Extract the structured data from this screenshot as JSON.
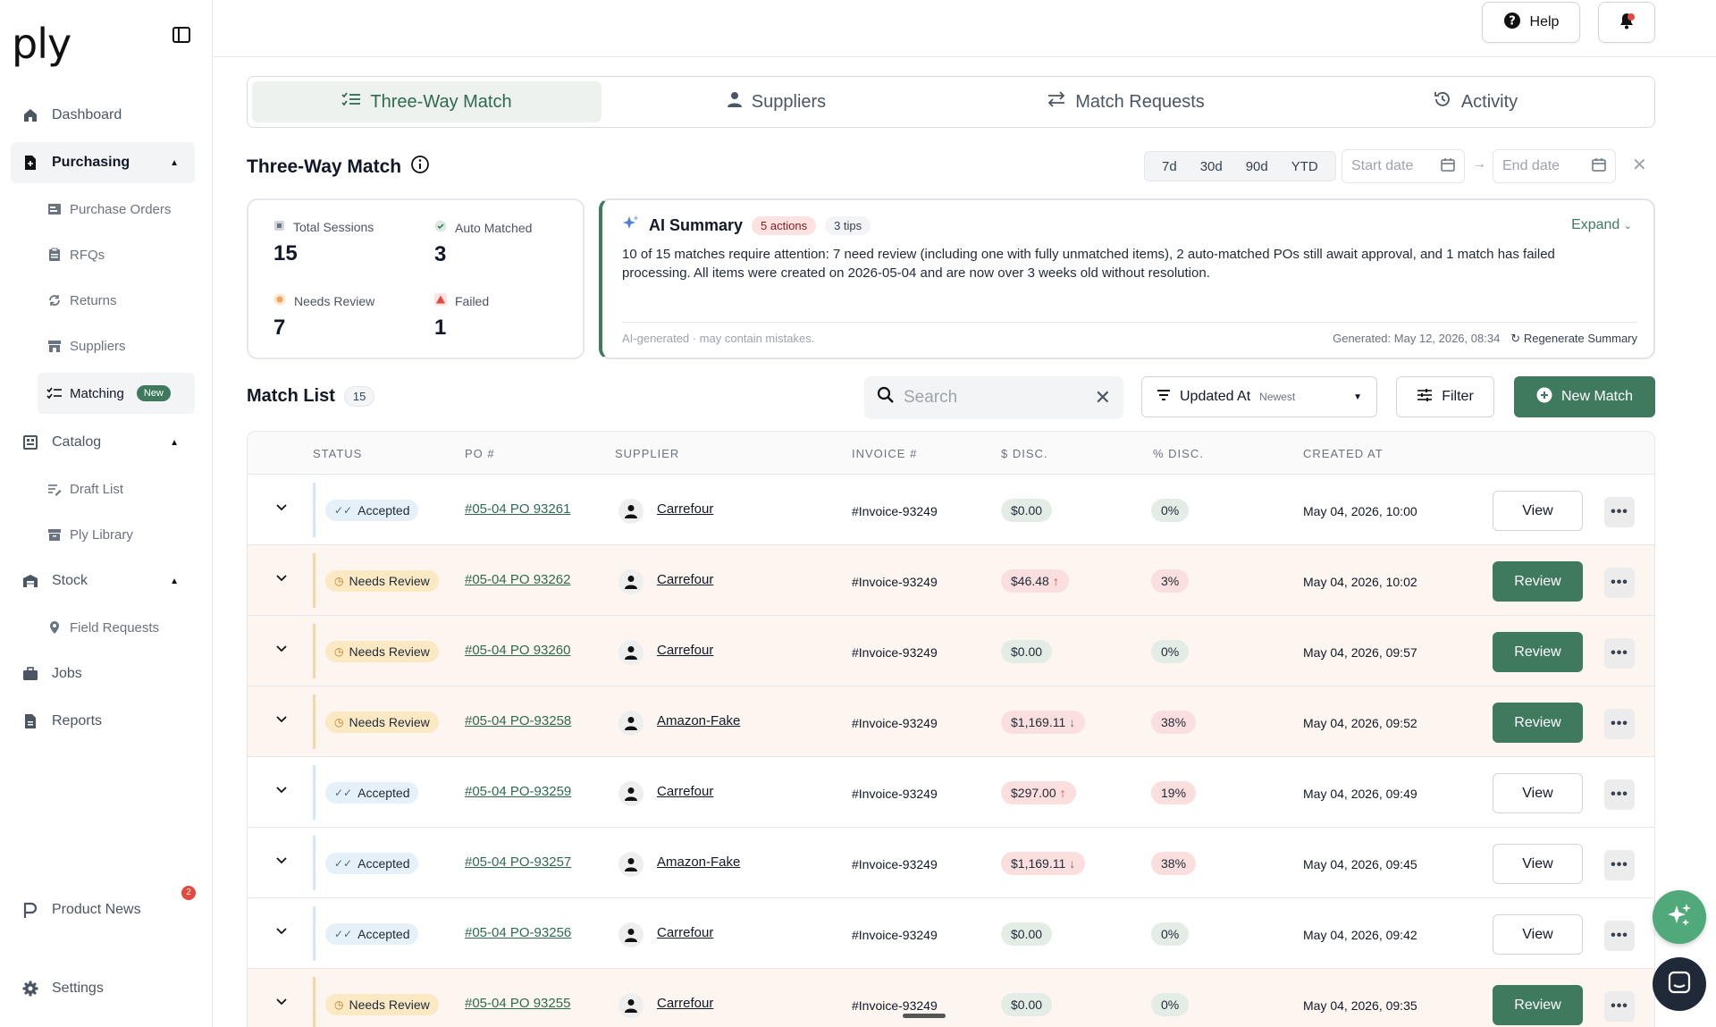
{
  "app": {
    "logo": "ply"
  },
  "sidebar": {
    "dashboard": "Dashboard",
    "purchasing": "Purchasing",
    "purchasing_sub": [
      "Purchase Orders",
      "RFQs",
      "Returns",
      "Suppliers",
      "Matching"
    ],
    "matching_badge": "New",
    "catalog": "Catalog",
    "catalog_sub": [
      "Draft List",
      "Ply Library"
    ],
    "stock": "Stock",
    "stock_sub": [
      "Field Requests"
    ],
    "jobs": "Jobs",
    "reports": "Reports",
    "product_news": "Product News",
    "product_news_count": "2",
    "settings": "Settings"
  },
  "topbar": {
    "help": "Help"
  },
  "tabs": [
    "Three-Way Match",
    "Suppliers",
    "Match Requests",
    "Activity"
  ],
  "section": {
    "title": "Three-Way Match",
    "ranges": [
      "7d",
      "30d",
      "90d",
      "YTD"
    ],
    "start_placeholder": "Start date",
    "end_placeholder": "End date"
  },
  "stats": {
    "total_label": "Total Sessions",
    "total": "15",
    "auto_label": "Auto Matched",
    "auto": "3",
    "review_label": "Needs Review",
    "review": "7",
    "failed_label": "Failed",
    "failed": "1",
    "colors": {
      "total": "#9ca3af",
      "auto": "#3f7a5f",
      "review": "#f0a35e",
      "failed": "#e5483d"
    }
  },
  "ai": {
    "title": "AI Summary",
    "actions": "5 actions",
    "tips": "3 tips",
    "expand": "Expand",
    "text": "10 of 15 matches require attention: 7 need review (including one with fully unmatched items), 2 auto-matched POs still await approval, and 1 match has failed processing. All items were created on 2026-05-04 and are now over 3 weeks old without resolution.",
    "disclaimer": "AI-generated · may contain mistakes.",
    "generated": "Generated: May 12, 2026, 08:34",
    "regenerate": "Regenerate Summary"
  },
  "list": {
    "title": "Match List",
    "count": "15",
    "search_placeholder": "Search",
    "sort_label": "Updated At",
    "sort_sub": "Newest",
    "filter": "Filter",
    "new_match": "New Match",
    "columns": [
      "STATUS",
      "PO #",
      "SUPPLIER",
      "INVOICE #",
      "$ DISC.",
      "% DISC.",
      "CREATED AT"
    ],
    "rows": [
      {
        "status": "Accepted",
        "po": "#05-04 PO 93261",
        "supplier": "Carrefour",
        "invoice": "#Invoice-93249",
        "disc": "$0.00",
        "disc_dir": "",
        "pct": "0%",
        "created": "May 04, 2026, 10:00",
        "action": "View"
      },
      {
        "status": "Needs Review",
        "po": "#05-04 PO 93262",
        "supplier": "Carrefour",
        "invoice": "#Invoice-93249",
        "disc": "$46.48",
        "disc_dir": "↑",
        "pct": "3%",
        "created": "May 04, 2026, 10:02",
        "action": "Review"
      },
      {
        "status": "Needs Review",
        "po": "#05-04 PO 93260",
        "supplier": "Carrefour",
        "invoice": "#Invoice-93249",
        "disc": "$0.00",
        "disc_dir": "",
        "pct": "0%",
        "created": "May 04, 2026, 09:57",
        "action": "Review"
      },
      {
        "status": "Needs Review",
        "po": "#05-04 PO-93258",
        "supplier": "Amazon-Fake",
        "invoice": "#Invoice-93249",
        "disc": "$1,169.11",
        "disc_dir": "↓",
        "pct": "38%",
        "created": "May 04, 2026, 09:52",
        "action": "Review"
      },
      {
        "status": "Accepted",
        "po": "#05-04 PO-93259",
        "supplier": "Carrefour",
        "invoice": "#Invoice-93249",
        "disc": "$297.00",
        "disc_dir": "↑",
        "pct": "19%",
        "created": "May 04, 2026, 09:49",
        "action": "View"
      },
      {
        "status": "Accepted",
        "po": "#05-04 PO-93257",
        "supplier": "Amazon-Fake",
        "invoice": "#Invoice-93249",
        "disc": "$1,169.11",
        "disc_dir": "↓",
        "pct": "38%",
        "created": "May 04, 2026, 09:45",
        "action": "View"
      },
      {
        "status": "Accepted",
        "po": "#05-04 PO-93256",
        "supplier": "Carrefour",
        "invoice": "#Invoice-93249",
        "disc": "$0.00",
        "disc_dir": "",
        "pct": "0%",
        "created": "May 04, 2026, 09:42",
        "action": "View"
      },
      {
        "status": "Needs Review",
        "po": "#05-04 PO 93255",
        "supplier": "Carrefour",
        "invoice": "#Invoice-93249",
        "disc": "$0.00",
        "disc_dir": "",
        "pct": "0%",
        "created": "May 04, 2026, 09:35",
        "action": "Review"
      }
    ]
  },
  "colors": {
    "accent": "#3f7a5f",
    "review_row": "#fdf5ef",
    "badge_red": "#e5483d"
  }
}
